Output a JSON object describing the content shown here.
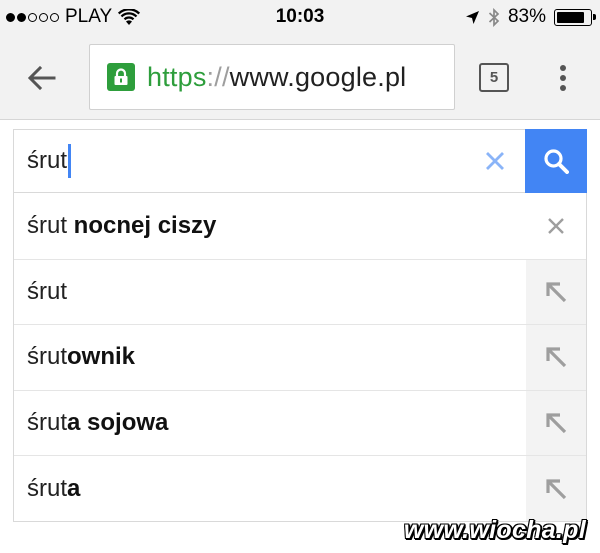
{
  "status_bar": {
    "carrier": "PLAY",
    "signal_bars_filled": 2,
    "signal_bars_total": 5,
    "time": "10:03",
    "battery_percent": "83%",
    "battery_level": 0.83,
    "icons": [
      "wifi-icon",
      "location-arrow-icon",
      "bluetooth-icon",
      "battery-icon"
    ]
  },
  "toolbar": {
    "url_scheme": "https",
    "url_separator": "://",
    "url_host": "www.google.pl",
    "tab_count": "5",
    "icons": [
      "back-arrow-icon",
      "lock-icon",
      "tabs-counter-icon",
      "overflow-menu-icon"
    ]
  },
  "search": {
    "query": "śrut",
    "icons": [
      "clear-icon",
      "search-icon"
    ]
  },
  "suggestions": [
    {
      "prefix": "śrut",
      "completion": " nocnej ciszy",
      "action": "remove"
    },
    {
      "prefix": "śrut",
      "completion": "",
      "action": "fill"
    },
    {
      "prefix": "śrut",
      "completion": "ownik",
      "action": "fill"
    },
    {
      "prefix": "śrut",
      "completion": "a sojowa",
      "action": "fill"
    },
    {
      "prefix": "śrut",
      "completion": "a",
      "action": "fill"
    }
  ],
  "watermark": "www.wiocha.pl",
  "colors": {
    "accent_blue": "#4285f4",
    "secure_green": "#2e9e3c",
    "chrome_gray": "#f2f2f2"
  }
}
